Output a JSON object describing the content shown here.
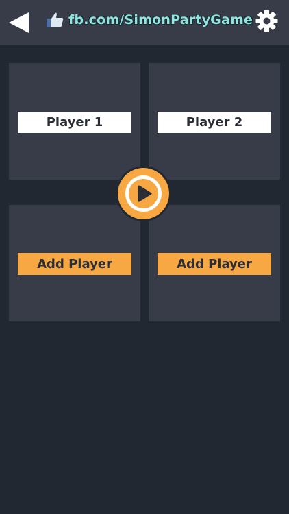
{
  "header": {
    "back_icon": "back-arrow-icon",
    "like_icon": "thumbs-up-icon",
    "fb_link_text": "fb.com/SimonPartyGame",
    "settings_icon": "gear-icon"
  },
  "players": [
    {
      "label": "Player 1"
    },
    {
      "label": "Player 2"
    }
  ],
  "empty_slots": [
    {
      "label": "Add Player"
    },
    {
      "label": "Add Player"
    }
  ],
  "play_icon": "play-icon",
  "colors": {
    "background": "#222831",
    "tile": "#383c48",
    "accent": "#f7a843",
    "link": "#8fe3e0",
    "name_label": "#ffffff"
  }
}
